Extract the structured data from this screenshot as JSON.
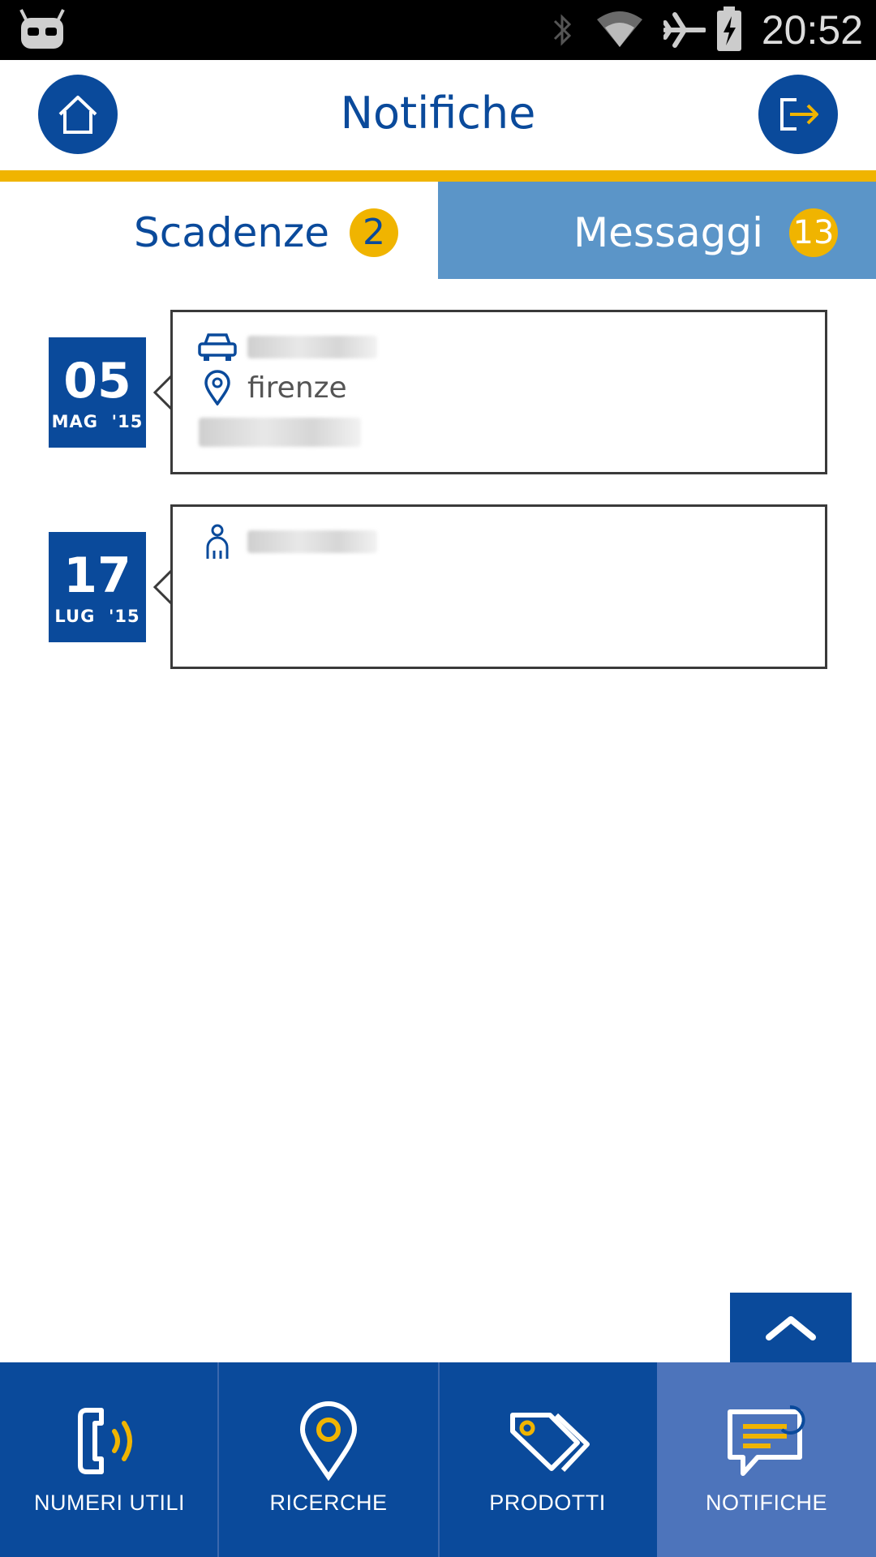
{
  "status_bar": {
    "time": "20:52",
    "icons": [
      "cyanogen-robot-icon",
      "bluetooth-icon",
      "wifi-icon",
      "airplane-icon",
      "battery-icon"
    ]
  },
  "header": {
    "title": "Notifiche",
    "left_button_icon": "home-icon",
    "right_button_icon": "logout-icon"
  },
  "tabs": [
    {
      "label": "Scadenze",
      "badge": "2",
      "active": false
    },
    {
      "label": "Messaggi",
      "badge": "13",
      "active": true
    }
  ],
  "notifications": [
    {
      "day": "05",
      "month": "MAG",
      "year": "'15",
      "rows": [
        {
          "icon": "car-icon",
          "text": "",
          "blurred": true
        },
        {
          "icon": "location-pin-icon",
          "text": "firenze",
          "blurred": false
        },
        {
          "icon": "",
          "text": "",
          "blurred": true
        }
      ]
    },
    {
      "day": "17",
      "month": "LUG",
      "year": "'15",
      "rows": [
        {
          "icon": "person-icon",
          "text": "",
          "blurred": true
        }
      ]
    }
  ],
  "bottom_nav": [
    {
      "label": "NUMERI UTILI",
      "icon": "phone-signal-icon",
      "active": false
    },
    {
      "label": "RICERCHE",
      "icon": "location-pin-icon",
      "active": false
    },
    {
      "label": "PRODOTTI",
      "icon": "tags-icon",
      "active": false
    },
    {
      "label": "NOTIFICHE",
      "icon": "chat-bubble-icon",
      "active": true
    }
  ],
  "colors": {
    "primary": "#0a4a9b",
    "accent": "#f0b400",
    "tab_active": "#5b95c8",
    "nav_active": "#4d74bb"
  }
}
